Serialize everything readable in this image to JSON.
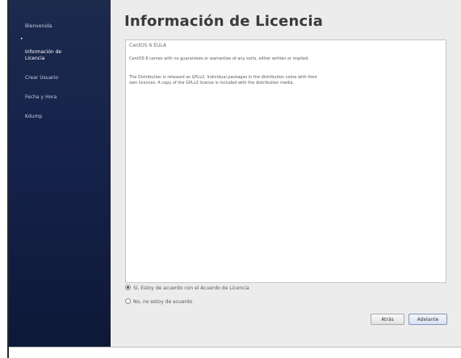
{
  "sidebar": {
    "items": [
      {
        "label": "Bienvenida",
        "active": false
      },
      {
        "label": "Información de\nLicencia",
        "active": true
      },
      {
        "label": "Crear Usuario",
        "active": false
      },
      {
        "label": "Fecha y Hora",
        "active": false
      },
      {
        "label": "Kdump",
        "active": false
      }
    ],
    "bullet": "•"
  },
  "main": {
    "title": "Información de Licencia",
    "license": {
      "header": "CentOS 6 EULA",
      "paragraphs": [
        "CentOS 6 comes with no guarantees or warranties of any sorts, either written or implied.",
        "The Distribution is released as GPLv2. Individual packages in the distribution come with their own licences. A copy of the GPLv2 license is included with the distribution media."
      ]
    },
    "options": [
      {
        "label": "Sí, Estoy de acuerdo con el Acuerdo de Licencia",
        "checked": true
      },
      {
        "label": "No, no estoy de acuerdo",
        "checked": false
      }
    ],
    "buttons": {
      "back": "Atrás",
      "forward": "Adelante"
    }
  },
  "colors": {
    "sidebar_top": "#1c2a4e",
    "sidebar_bottom": "#0e1838",
    "window_bg": "#ececec"
  }
}
